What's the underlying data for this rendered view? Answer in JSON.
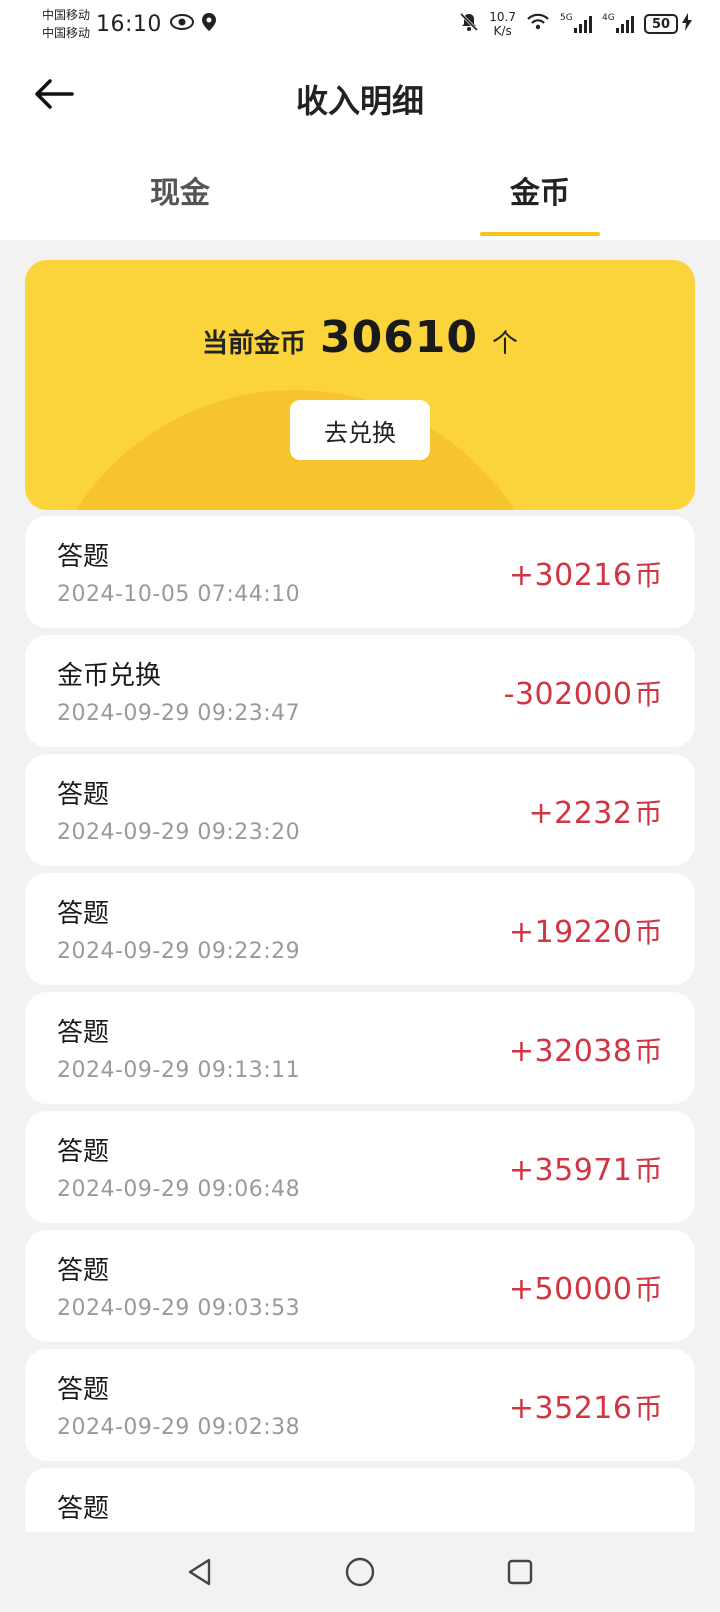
{
  "status_bar": {
    "carrier_1": "中国移动",
    "carrier_2": "中国移动",
    "time": "16:10",
    "speed_value": "10.7",
    "speed_unit": "K/s",
    "net_1": "5G",
    "net_2": "4G",
    "battery": "50",
    "icons": [
      "eye-icon",
      "location-icon",
      "mute-icon",
      "wifi-icon",
      "signal-icon",
      "battery-icon",
      "charging-icon"
    ]
  },
  "header": {
    "title": "收入明细",
    "back_icon": "arrow-left-icon"
  },
  "tabs": [
    {
      "label": "现金",
      "active": false
    },
    {
      "label": "金币",
      "active": true
    }
  ],
  "balance": {
    "label": "当前金币",
    "value": "30610",
    "unit": "个",
    "button_label": "去兑换"
  },
  "records": [
    {
      "title": "答题",
      "time": "2024-10-05 07:44:10",
      "amount": "+30216",
      "unit": "币"
    },
    {
      "title": "金币兑换",
      "time": "2024-09-29 09:23:47",
      "amount": "-302000",
      "unit": "币"
    },
    {
      "title": "答题",
      "time": "2024-09-29 09:23:20",
      "amount": "+2232",
      "unit": "币"
    },
    {
      "title": "答题",
      "time": "2024-09-29 09:22:29",
      "amount": "+19220",
      "unit": "币"
    },
    {
      "title": "答题",
      "time": "2024-09-29 09:13:11",
      "amount": "+32038",
      "unit": "币"
    },
    {
      "title": "答题",
      "time": "2024-09-29 09:06:48",
      "amount": "+35971",
      "unit": "币"
    },
    {
      "title": "答题",
      "time": "2024-09-29 09:03:53",
      "amount": "+50000",
      "unit": "币"
    },
    {
      "title": "答题",
      "time": "2024-09-29 09:02:38",
      "amount": "+35216",
      "unit": "币"
    },
    {
      "title": "答题",
      "time": "",
      "amount": "",
      "unit": ""
    }
  ],
  "colors": {
    "accent_yellow": "#f5c518",
    "card_yellow": "#fbd33a",
    "amount_red": "#d23542"
  },
  "nav_bar": {
    "icons": [
      "back-triangle-icon",
      "home-circle-icon",
      "recents-square-icon"
    ]
  }
}
